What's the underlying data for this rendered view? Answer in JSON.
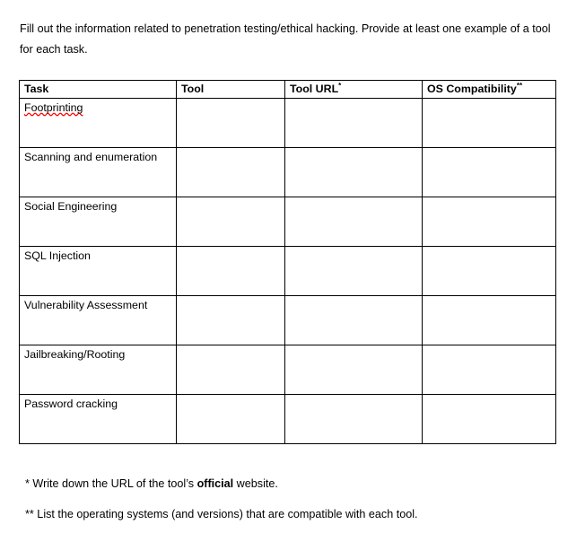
{
  "document": {
    "intro_paragraph": "Fill out the information related to penetration testing/ethical hacking.  Provide at least one example of a tool for each task.",
    "table": {
      "headers": [
        {
          "label": "Task",
          "marker": ""
        },
        {
          "label": "Tool",
          "marker": ""
        },
        {
          "label": "Tool URL",
          "marker": "*"
        },
        {
          "label": "OS Compatibility",
          "marker": "**"
        }
      ],
      "rows": [
        {
          "task": "Footprinting",
          "misspelled": true,
          "tool": "",
          "tool_url": "",
          "os_compatibility": ""
        },
        {
          "task": "Scanning and enumeration",
          "misspelled": false,
          "tool": "",
          "tool_url": "",
          "os_compatibility": ""
        },
        {
          "task": "Social Engineering",
          "misspelled": false,
          "tool": "",
          "tool_url": "",
          "os_compatibility": ""
        },
        {
          "task": "SQL Injection",
          "misspelled": false,
          "tool": "",
          "tool_url": "",
          "os_compatibility": ""
        },
        {
          "task": "Vulnerability Assessment",
          "misspelled": false,
          "tool": "",
          "tool_url": "",
          "os_compatibility": ""
        },
        {
          "task": "Jailbreaking/Rooting",
          "misspelled": false,
          "tool": "",
          "tool_url": "",
          "os_compatibility": ""
        },
        {
          "task": "Password cracking",
          "misspelled": false,
          "tool": "",
          "tool_url": "",
          "os_compatibility": ""
        }
      ]
    },
    "footnotes": [
      {
        "marker": "*",
        "text_before": " Write down the URL of the tool’s ",
        "bold_text": "official",
        "text_after": " website."
      },
      {
        "marker": "**",
        "text_before": " List the operating systems (and versions) that are compatible with each tool.",
        "bold_text": "",
        "text_after": ""
      }
    ]
  },
  "colors": {
    "text": "#000000",
    "border": "#000000",
    "spellcheck_underline": "#ff0000",
    "background": "#ffffff"
  }
}
